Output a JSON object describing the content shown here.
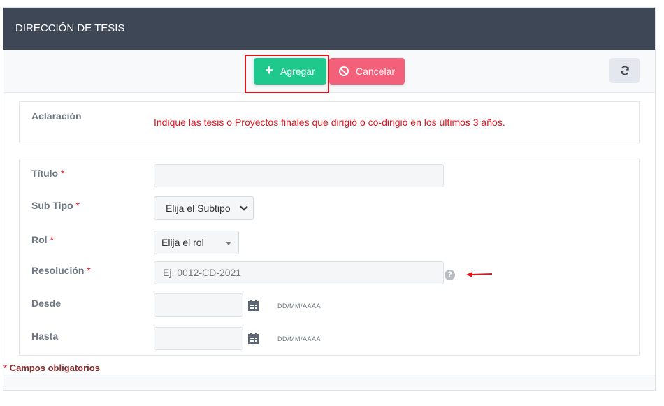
{
  "header": {
    "title": "DIRECCIÓN DE TESIS"
  },
  "toolbar": {
    "add_label": "Agregar",
    "cancel_label": "Cancelar",
    "add_color": "#1fc98e",
    "cancel_color": "#f3607a",
    "refresh_icon": "refresh-icon"
  },
  "note": {
    "label": "Aclaración",
    "text": "Indique las tesis o Proyectos finales que dirigió o co-dirigió en los últimos 3 años."
  },
  "form": {
    "titulo": {
      "label": "Título",
      "required": "*",
      "value": ""
    },
    "subtipo": {
      "label": "Sub Tipo",
      "required": "*",
      "selected": "Elija el Subtipo"
    },
    "rol": {
      "label": "Rol",
      "required": "*",
      "selected": "Elija el rol"
    },
    "resolucion": {
      "label": "Resolución",
      "required": "*",
      "placeholder": "Ej. 0012-CD-2021"
    },
    "desde": {
      "label": "Desde",
      "value": "",
      "hint": "DD/MM/AAAA"
    },
    "hasta": {
      "label": "Hasta",
      "value": "",
      "hint": "DD/MM/AAAA"
    }
  },
  "footer": {
    "required_star": "*",
    "required_note": " Campos obligatorios"
  },
  "colors": {
    "header_bg": "#3e4756",
    "required": "#e3131c"
  }
}
